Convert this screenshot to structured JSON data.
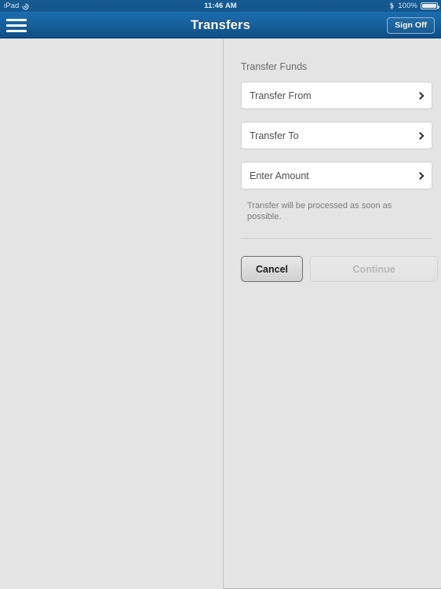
{
  "status_bar": {
    "device_label": "iPad",
    "rotation_lock_icon": "rotation-lock-icon",
    "time": "11:46 AM",
    "bluetooth_icon": "bluetooth-icon",
    "battery_percent": "100%",
    "battery_icon": "battery-full-icon"
  },
  "nav": {
    "menu_icon": "hamburger-menu-icon",
    "title": "Transfers",
    "sign_off_label": "Sign Off",
    "accent_color": "#16629f"
  },
  "main": {
    "section_title": "Transfer Funds",
    "fields": [
      {
        "label": "Transfer From",
        "value": "",
        "chevron_icon": "chevron-right-icon"
      },
      {
        "label": "Transfer To",
        "value": "",
        "chevron_icon": "chevron-right-icon"
      },
      {
        "label": "Enter Amount",
        "value": "",
        "chevron_icon": "chevron-right-icon"
      }
    ],
    "note": "Transfer will be processed as soon as possible.",
    "buttons": {
      "cancel_label": "Cancel",
      "continue_label": "Continue"
    }
  }
}
